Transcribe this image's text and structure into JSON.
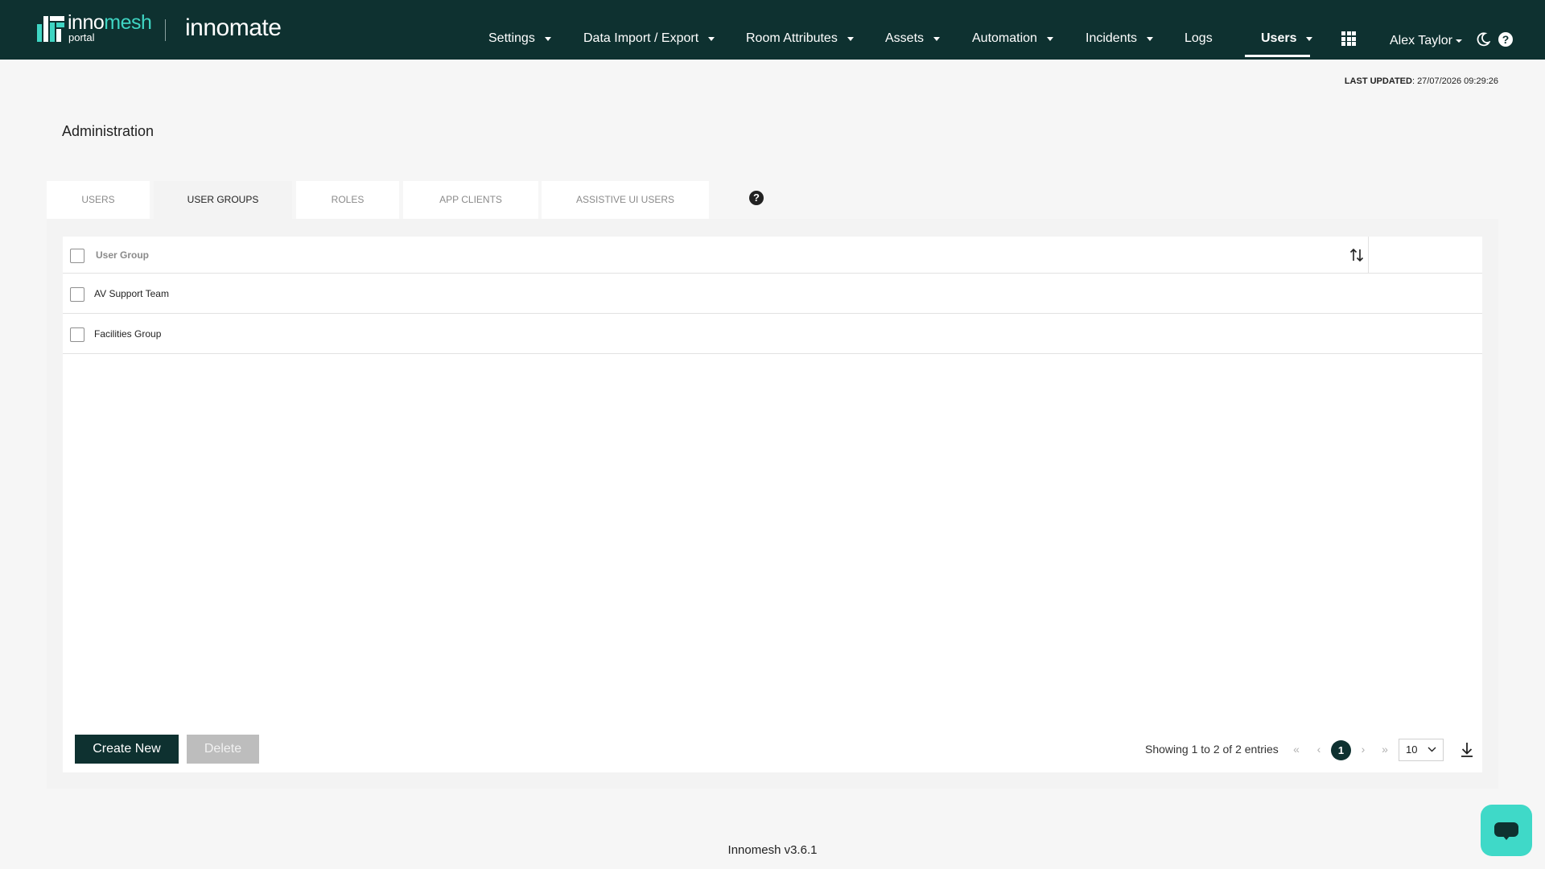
{
  "brand": {
    "logo_name_part1": "inno",
    "logo_name_part2": "mesh",
    "logo_sub": "portal",
    "app_name": "innomate"
  },
  "nav": {
    "items": [
      {
        "label": "Settings"
      },
      {
        "label": "Data Import / Export"
      },
      {
        "label": "Room Attributes"
      },
      {
        "label": "Assets"
      },
      {
        "label": "Automation"
      },
      {
        "label": "Incidents"
      },
      {
        "label": "Logs"
      },
      {
        "label": "Users"
      }
    ],
    "active": "Users",
    "user_name": "Alex Taylor"
  },
  "icons": {
    "apps": "grid-icon",
    "theme": "moon-icon",
    "help": "help-icon",
    "sort": "sort-icon",
    "download": "download-icon",
    "chat": "chat-icon"
  },
  "header": {
    "last_updated_label": "LAST UPDATED",
    "last_updated_value": ": 27/07/2026 09:29:26",
    "title": "Administration"
  },
  "tabs": [
    {
      "label": "USERS"
    },
    {
      "label": "USER GROUPS"
    },
    {
      "label": "ROLES"
    },
    {
      "label": "APP CLIENTS"
    },
    {
      "label": "ASSISTIVE UI USERS"
    }
  ],
  "active_tab": "USER GROUPS",
  "help_glyph": "?",
  "table": {
    "column_header": "User Group",
    "rows": [
      {
        "name": "AV Support Team"
      },
      {
        "name": "Facilities Group"
      }
    ]
  },
  "actions": {
    "create_label": "Create New",
    "delete_label": "Delete"
  },
  "pagination": {
    "summary": "Showing 1 to 2 of 2 entries",
    "first": "«",
    "prev": "‹",
    "current_page": "1",
    "next": "›",
    "last": "»",
    "page_size": "10"
  },
  "footer": {
    "version": "Innomesh v3.6.1"
  },
  "colors": {
    "navbar": "#0e3130",
    "accent": "#3fd5c3",
    "chat_button": "#3fd9c8",
    "disabled": "#bdbdbd"
  }
}
